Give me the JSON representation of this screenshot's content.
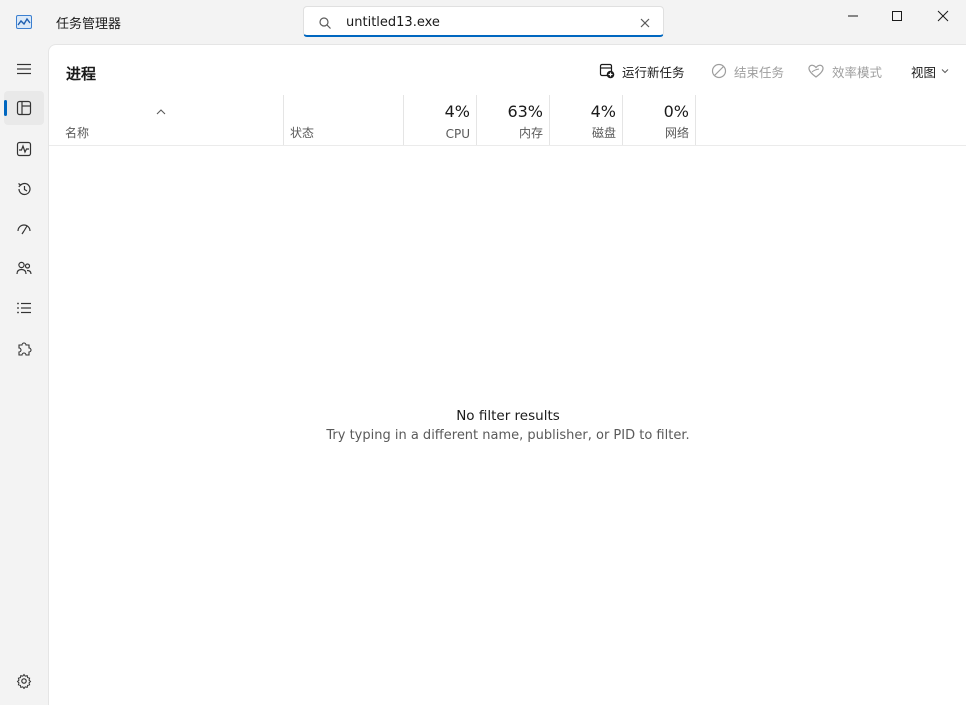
{
  "window": {
    "title": "任务管理器",
    "icons": {
      "app": "performance-chart-icon",
      "minimize": "minimize-icon",
      "maximize": "maximize-icon",
      "close": "close-icon"
    }
  },
  "search": {
    "value": "untitled13.exe",
    "placeholder": "",
    "icon": "search-icon",
    "clear_icon": "clear-icon"
  },
  "nav": {
    "items": [
      {
        "name": "hamburger-menu",
        "icon": "menu-icon",
        "active": false
      },
      {
        "name": "processes",
        "icon": "processes-icon",
        "active": true
      },
      {
        "name": "performance",
        "icon": "pulse-icon",
        "active": false
      },
      {
        "name": "app-history",
        "icon": "history-icon",
        "active": false
      },
      {
        "name": "startup-apps",
        "icon": "speedometer-icon",
        "active": false
      },
      {
        "name": "users",
        "icon": "users-icon",
        "active": false
      },
      {
        "name": "details",
        "icon": "list-icon",
        "active": false
      },
      {
        "name": "services",
        "icon": "puzzle-icon",
        "active": false
      }
    ],
    "settings_icon": "gear-icon"
  },
  "page": {
    "title": "进程"
  },
  "toolbar": {
    "run_new_task": "运行新任务",
    "end_task": "结束任务",
    "efficiency_mode": "效率模式",
    "view": "视图"
  },
  "columns": {
    "name": "名称",
    "status": "状态",
    "cpu": {
      "value": "4%",
      "label": "CPU"
    },
    "memory": {
      "value": "63%",
      "label": "内存"
    },
    "disk": {
      "value": "4%",
      "label": "磁盘"
    },
    "network": {
      "value": "0%",
      "label": "网络"
    }
  },
  "empty_state": {
    "title": "No filter results",
    "subtitle": "Try typing in a different name, publisher, or PID to filter."
  },
  "colors": {
    "accent": "#0067c0",
    "background": "#f3f3f3",
    "panel": "#ffffff",
    "disabled_text": "#9e9e9e"
  }
}
